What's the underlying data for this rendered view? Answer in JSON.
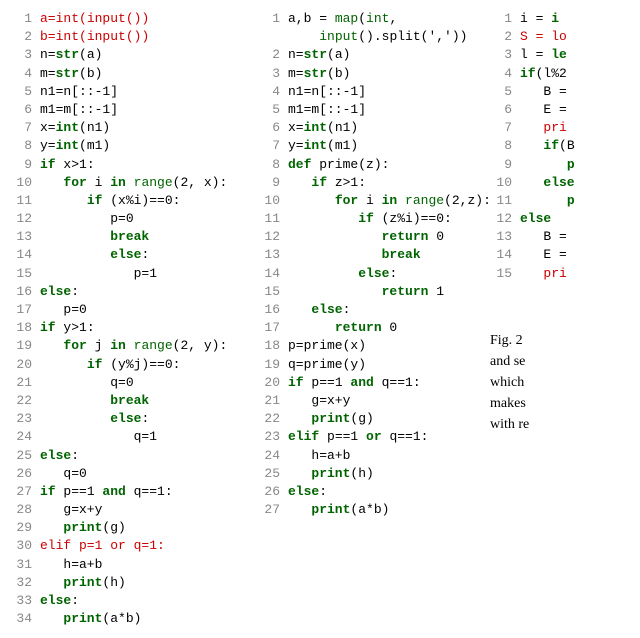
{
  "col1": [
    {
      "n": 1,
      "parts": [
        {
          "t": "a=",
          "c": "err"
        },
        {
          "t": "int",
          "c": "err"
        },
        {
          "t": "(",
          "c": "err"
        },
        {
          "t": "input",
          "c": "err"
        },
        {
          "t": "())",
          "c": "err"
        }
      ]
    },
    {
      "n": 2,
      "parts": [
        {
          "t": "b=",
          "c": "err"
        },
        {
          "t": "int",
          "c": "err"
        },
        {
          "t": "(",
          "c": "err"
        },
        {
          "t": "input",
          "c": "err"
        },
        {
          "t": "())",
          "c": "err"
        }
      ]
    },
    {
      "n": 3,
      "parts": [
        {
          "t": "n="
        },
        {
          "t": "str",
          "c": "kw"
        },
        {
          "t": "(a)"
        }
      ]
    },
    {
      "n": 4,
      "parts": [
        {
          "t": "m="
        },
        {
          "t": "str",
          "c": "kw"
        },
        {
          "t": "(b)"
        }
      ]
    },
    {
      "n": 5,
      "parts": [
        {
          "t": "n1=n[::-1]"
        }
      ]
    },
    {
      "n": 6,
      "parts": [
        {
          "t": "m1=m[::-1]"
        }
      ]
    },
    {
      "n": 7,
      "parts": [
        {
          "t": "x="
        },
        {
          "t": "int",
          "c": "kw"
        },
        {
          "t": "(n1)"
        }
      ]
    },
    {
      "n": 8,
      "parts": [
        {
          "t": "y="
        },
        {
          "t": "int",
          "c": "kw"
        },
        {
          "t": "(m1)"
        }
      ]
    },
    {
      "n": 9,
      "parts": [
        {
          "t": "if",
          "c": "kw"
        },
        {
          "t": " x>1:"
        }
      ]
    },
    {
      "n": 10,
      "parts": [
        {
          "t": "   "
        },
        {
          "t": "for",
          "c": "kw"
        },
        {
          "t": " i "
        },
        {
          "t": "in",
          "c": "kw"
        },
        {
          "t": " "
        },
        {
          "t": "range",
          "c": "bi"
        },
        {
          "t": "(2, x):"
        }
      ]
    },
    {
      "n": 11,
      "parts": [
        {
          "t": "      "
        },
        {
          "t": "if",
          "c": "kw"
        },
        {
          "t": " (x%i)==0:"
        }
      ]
    },
    {
      "n": 12,
      "parts": [
        {
          "t": "         p=0"
        }
      ]
    },
    {
      "n": 13,
      "parts": [
        {
          "t": "         "
        },
        {
          "t": "break",
          "c": "kw"
        }
      ]
    },
    {
      "n": 14,
      "parts": [
        {
          "t": "         "
        },
        {
          "t": "else",
          "c": "kw"
        },
        {
          "t": ":"
        }
      ]
    },
    {
      "n": 15,
      "parts": [
        {
          "t": "            p=1"
        }
      ]
    },
    {
      "n": 16,
      "parts": [
        {
          "t": "else",
          "c": "kw"
        },
        {
          "t": ":"
        }
      ]
    },
    {
      "n": 17,
      "parts": [
        {
          "t": "   p=0"
        }
      ]
    },
    {
      "n": 18,
      "parts": [
        {
          "t": "if",
          "c": "kw"
        },
        {
          "t": " y>1:"
        }
      ]
    },
    {
      "n": 19,
      "parts": [
        {
          "t": "   "
        },
        {
          "t": "for",
          "c": "kw"
        },
        {
          "t": " j "
        },
        {
          "t": "in",
          "c": "kw"
        },
        {
          "t": " "
        },
        {
          "t": "range",
          "c": "bi"
        },
        {
          "t": "(2, y):"
        }
      ]
    },
    {
      "n": 20,
      "parts": [
        {
          "t": "      "
        },
        {
          "t": "if",
          "c": "kw"
        },
        {
          "t": " (y%j)==0:"
        }
      ]
    },
    {
      "n": 21,
      "parts": [
        {
          "t": "         q=0"
        }
      ]
    },
    {
      "n": 22,
      "parts": [
        {
          "t": "         "
        },
        {
          "t": "break",
          "c": "kw"
        }
      ]
    },
    {
      "n": 23,
      "parts": [
        {
          "t": "         "
        },
        {
          "t": "else",
          "c": "kw"
        },
        {
          "t": ":"
        }
      ]
    },
    {
      "n": 24,
      "parts": [
        {
          "t": "            q=1"
        }
      ]
    },
    {
      "n": 25,
      "parts": [
        {
          "t": "else",
          "c": "kw"
        },
        {
          "t": ":"
        }
      ]
    },
    {
      "n": 26,
      "parts": [
        {
          "t": "   q=0"
        }
      ]
    },
    {
      "n": 27,
      "parts": [
        {
          "t": "if",
          "c": "kw"
        },
        {
          "t": " p==1 "
        },
        {
          "t": "and",
          "c": "kw"
        },
        {
          "t": " q==1:"
        }
      ]
    },
    {
      "n": 28,
      "parts": [
        {
          "t": "   g=x+y"
        }
      ]
    },
    {
      "n": 29,
      "parts": [
        {
          "t": "   "
        },
        {
          "t": "print",
          "c": "kw"
        },
        {
          "t": "(g)"
        }
      ]
    },
    {
      "n": 30,
      "parts": [
        {
          "t": "elif p=1 or q=1:",
          "c": "err"
        }
      ]
    },
    {
      "n": 31,
      "parts": [
        {
          "t": "   h=a+b"
        }
      ]
    },
    {
      "n": 32,
      "parts": [
        {
          "t": "   "
        },
        {
          "t": "print",
          "c": "kw"
        },
        {
          "t": "(h)"
        }
      ]
    },
    {
      "n": 33,
      "parts": [
        {
          "t": "else",
          "c": "kw"
        },
        {
          "t": ":"
        }
      ]
    },
    {
      "n": 34,
      "parts": [
        {
          "t": "   "
        },
        {
          "t": "print",
          "c": "kw"
        },
        {
          "t": "(a*b)"
        }
      ]
    }
  ],
  "col2": [
    {
      "n": 1,
      "parts": [
        {
          "t": "a,b = "
        },
        {
          "t": "map",
          "c": "bi"
        },
        {
          "t": "("
        },
        {
          "t": "int",
          "c": "bi"
        },
        {
          "t": ","
        }
      ]
    },
    {
      "n": null,
      "parts": [
        {
          "t": "    "
        },
        {
          "t": "input",
          "c": "bi"
        },
        {
          "t": "().split(','))"
        }
      ]
    },
    {
      "n": 2,
      "parts": [
        {
          "t": "n="
        },
        {
          "t": "str",
          "c": "kw"
        },
        {
          "t": "(a)"
        }
      ]
    },
    {
      "n": 3,
      "parts": [
        {
          "t": "m="
        },
        {
          "t": "str",
          "c": "kw"
        },
        {
          "t": "(b)"
        }
      ]
    },
    {
      "n": 4,
      "parts": [
        {
          "t": "n1=n[::-1]"
        }
      ]
    },
    {
      "n": 5,
      "parts": [
        {
          "t": "m1=m[::-1]"
        }
      ]
    },
    {
      "n": 6,
      "parts": [
        {
          "t": "x="
        },
        {
          "t": "int",
          "c": "kw"
        },
        {
          "t": "(n1)"
        }
      ]
    },
    {
      "n": 7,
      "parts": [
        {
          "t": "y="
        },
        {
          "t": "int",
          "c": "kw"
        },
        {
          "t": "(m1)"
        }
      ]
    },
    {
      "n": 8,
      "parts": [
        {
          "t": "def",
          "c": "kw"
        },
        {
          "t": " prime(z):"
        }
      ]
    },
    {
      "n": 9,
      "parts": [
        {
          "t": "   "
        },
        {
          "t": "if",
          "c": "kw"
        },
        {
          "t": " z>1:"
        }
      ]
    },
    {
      "n": 10,
      "parts": [
        {
          "t": "      "
        },
        {
          "t": "for",
          "c": "kw"
        },
        {
          "t": " i "
        },
        {
          "t": "in",
          "c": "kw"
        },
        {
          "t": " "
        },
        {
          "t": "range",
          "c": "bi"
        },
        {
          "t": "(2,z):"
        }
      ]
    },
    {
      "n": 11,
      "parts": [
        {
          "t": "         "
        },
        {
          "t": "if",
          "c": "kw"
        },
        {
          "t": " (z%i)==0:"
        }
      ]
    },
    {
      "n": 12,
      "parts": [
        {
          "t": "            "
        },
        {
          "t": "return",
          "c": "kw"
        },
        {
          "t": " 0"
        }
      ]
    },
    {
      "n": 13,
      "parts": [
        {
          "t": "            "
        },
        {
          "t": "break",
          "c": "kw"
        }
      ]
    },
    {
      "n": 14,
      "parts": [
        {
          "t": "         "
        },
        {
          "t": "else",
          "c": "kw"
        },
        {
          "t": ":"
        }
      ]
    },
    {
      "n": 15,
      "parts": [
        {
          "t": "            "
        },
        {
          "t": "return",
          "c": "kw"
        },
        {
          "t": " 1"
        }
      ]
    },
    {
      "n": 16,
      "parts": [
        {
          "t": "   "
        },
        {
          "t": "else",
          "c": "kw"
        },
        {
          "t": ":"
        }
      ]
    },
    {
      "n": 17,
      "parts": [
        {
          "t": "      "
        },
        {
          "t": "return",
          "c": "kw"
        },
        {
          "t": " 0"
        }
      ]
    },
    {
      "n": 18,
      "parts": [
        {
          "t": "p=prime(x)"
        }
      ]
    },
    {
      "n": 19,
      "parts": [
        {
          "t": "q=prime(y)"
        }
      ]
    },
    {
      "n": 20,
      "parts": [
        {
          "t": "if",
          "c": "kw"
        },
        {
          "t": " p==1 "
        },
        {
          "t": "and",
          "c": "kw"
        },
        {
          "t": " q==1:"
        }
      ]
    },
    {
      "n": 21,
      "parts": [
        {
          "t": "   g=x+y"
        }
      ]
    },
    {
      "n": 22,
      "parts": [
        {
          "t": "   "
        },
        {
          "t": "print",
          "c": "kw"
        },
        {
          "t": "(g)"
        }
      ]
    },
    {
      "n": 23,
      "parts": [
        {
          "t": "elif",
          "c": "kw"
        },
        {
          "t": " p==1 "
        },
        {
          "t": "or",
          "c": "kw"
        },
        {
          "t": " q==1:"
        }
      ]
    },
    {
      "n": 24,
      "parts": [
        {
          "t": "   h=a+b"
        }
      ]
    },
    {
      "n": 25,
      "parts": [
        {
          "t": "   "
        },
        {
          "t": "print",
          "c": "kw"
        },
        {
          "t": "(h)"
        }
      ]
    },
    {
      "n": 26,
      "parts": [
        {
          "t": "else",
          "c": "kw"
        },
        {
          "t": ":"
        }
      ]
    },
    {
      "n": 27,
      "parts": [
        {
          "t": "   "
        },
        {
          "t": "print",
          "c": "kw"
        },
        {
          "t": "(a*b)"
        }
      ]
    }
  ],
  "col3": [
    {
      "n": 1,
      "parts": [
        {
          "t": "i = "
        },
        {
          "t": "i",
          "c": "kw"
        }
      ]
    },
    {
      "n": 2,
      "parts": [
        {
          "t": "S = lo",
          "c": "err"
        }
      ]
    },
    {
      "n": 3,
      "parts": [
        {
          "t": "l = "
        },
        {
          "t": "le",
          "c": "kw"
        }
      ]
    },
    {
      "n": 4,
      "parts": [
        {
          "t": "if",
          "c": "kw"
        },
        {
          "t": "(l%2"
        }
      ]
    },
    {
      "n": 5,
      "parts": [
        {
          "t": "   B ="
        }
      ]
    },
    {
      "n": 6,
      "parts": [
        {
          "t": "   E ="
        }
      ]
    },
    {
      "n": 7,
      "parts": [
        {
          "t": "   "
        },
        {
          "t": "pri",
          "c": "err"
        }
      ]
    },
    {
      "n": 8,
      "parts": [
        {
          "t": "   "
        },
        {
          "t": "if",
          "c": "kw"
        },
        {
          "t": "(B"
        }
      ]
    },
    {
      "n": 9,
      "parts": [
        {
          "t": "      "
        },
        {
          "t": "p",
          "c": "kw"
        }
      ]
    },
    {
      "n": null,
      "parts": [
        {
          "t": ""
        }
      ]
    },
    {
      "n": 10,
      "parts": [
        {
          "t": "   "
        },
        {
          "t": "else",
          "c": "kw"
        }
      ]
    },
    {
      "n": 11,
      "parts": [
        {
          "t": "      "
        },
        {
          "t": "p",
          "c": "kw"
        }
      ]
    },
    {
      "n": null,
      "parts": [
        {
          "t": ""
        }
      ]
    },
    {
      "n": 12,
      "parts": [
        {
          "t": "else",
          "c": "kw"
        }
      ]
    },
    {
      "n": 13,
      "parts": [
        {
          "t": "   B ="
        }
      ]
    },
    {
      "n": 14,
      "parts": [
        {
          "t": "   E ="
        }
      ]
    },
    {
      "n": 15,
      "parts": [
        {
          "t": "   "
        },
        {
          "t": "pri",
          "c": "err"
        }
      ]
    }
  ],
  "figlabel": "(",
  "caption_lines": [
    "Fig. 2",
    "and se",
    "which",
    "makes",
    "with re"
  ]
}
